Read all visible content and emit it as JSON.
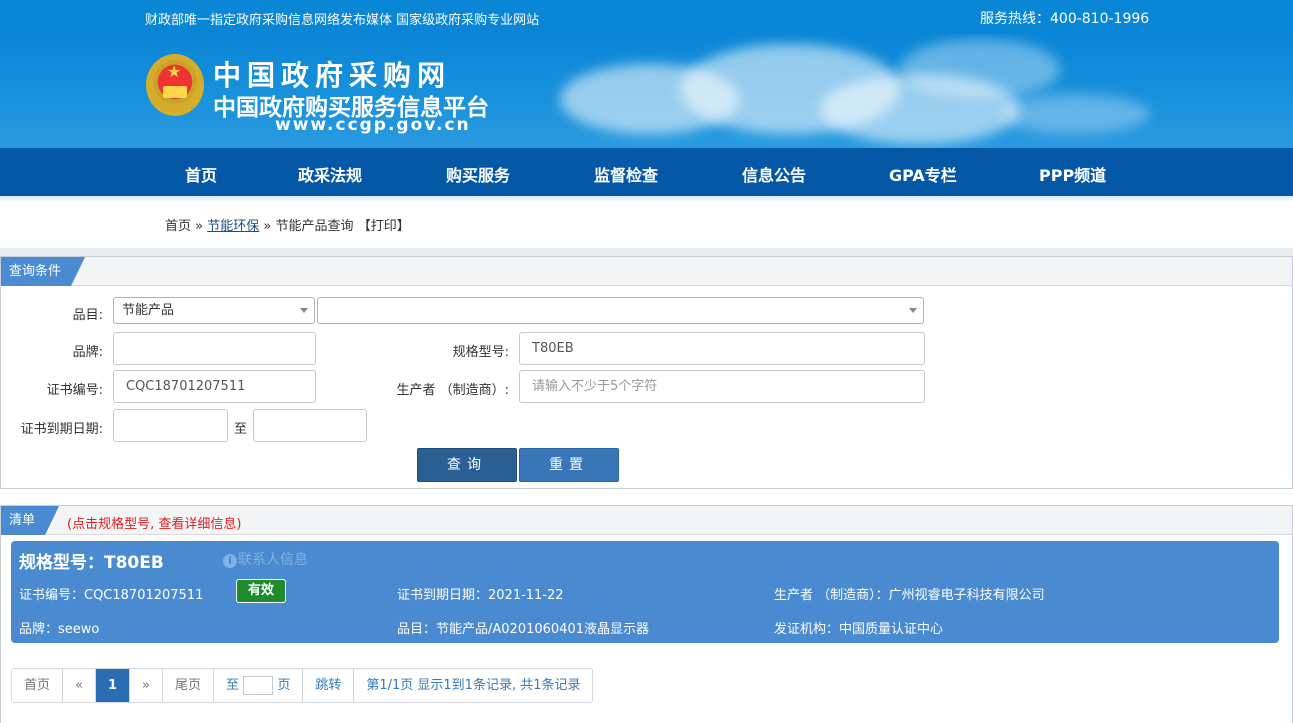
{
  "topbar": {
    "slogan": "财政部唯一指定政府采购信息网络发布媒体 国家级政府采购专业网站",
    "hotline": "服务热线：400-810-1996"
  },
  "banner": {
    "line1": "中国政府采购网",
    "line2": "中国政府购买服务信息平台",
    "url": "www.ccgp.gov.cn"
  },
  "nav": [
    "首页",
    "政采法规",
    "购买服务",
    "监督检查",
    "信息公告",
    "GPA专栏",
    "PPP频道"
  ],
  "breadcrumb": {
    "home": "首页",
    "sep1": "»",
    "section": "节能环保",
    "sep2": "»",
    "current": "节能产品查询",
    "print": "【打印】"
  },
  "query": {
    "tag": "查询条件",
    "category_label": "品目:",
    "category_value": "节能产品",
    "subcategory_value": "",
    "brand_label": "品牌:",
    "brand_value": "",
    "model_label": "规格型号:",
    "model_value": "T80EB",
    "cert_label": "证书编号:",
    "cert_value": "CQC18701207511",
    "maker_label": "生产者 （制造商）:",
    "maker_placeholder": "请输入不少于5个字符",
    "expire_label": "证书到期日期:",
    "to_label": "至",
    "query_button": "查询",
    "reset_button": "重置"
  },
  "list": {
    "tag": "清单",
    "hint": "(点击规格型号, 查看详细信息)",
    "card": {
      "title": "规格型号：T80EB",
      "contact": "联系人信息",
      "cert": "证书编号：CQC18701207511",
      "status": "有效",
      "expire": "证书到期日期：2021-11-22",
      "maker": "生产者 （制造商）：广州视睿电子科技有限公司",
      "brand": "品牌：seewo",
      "category": "品目：节能产品/A0201060401液晶显示器",
      "issuer": "发证机构：中国质量认证中心"
    }
  },
  "pager": {
    "first": "首页",
    "prev": "«",
    "current": "1",
    "next": "»",
    "last": "尾页",
    "goto_prefix": "至",
    "goto_suffix": "页",
    "jump": "跳转",
    "summary": "第1/1页  显示1到1条记录, 共1条记录"
  },
  "colors": {
    "topbar": "#0a86d6",
    "nav": "#0458a6",
    "accent": "#4a8ad0",
    "valid_badge": "#1e8c2c"
  }
}
